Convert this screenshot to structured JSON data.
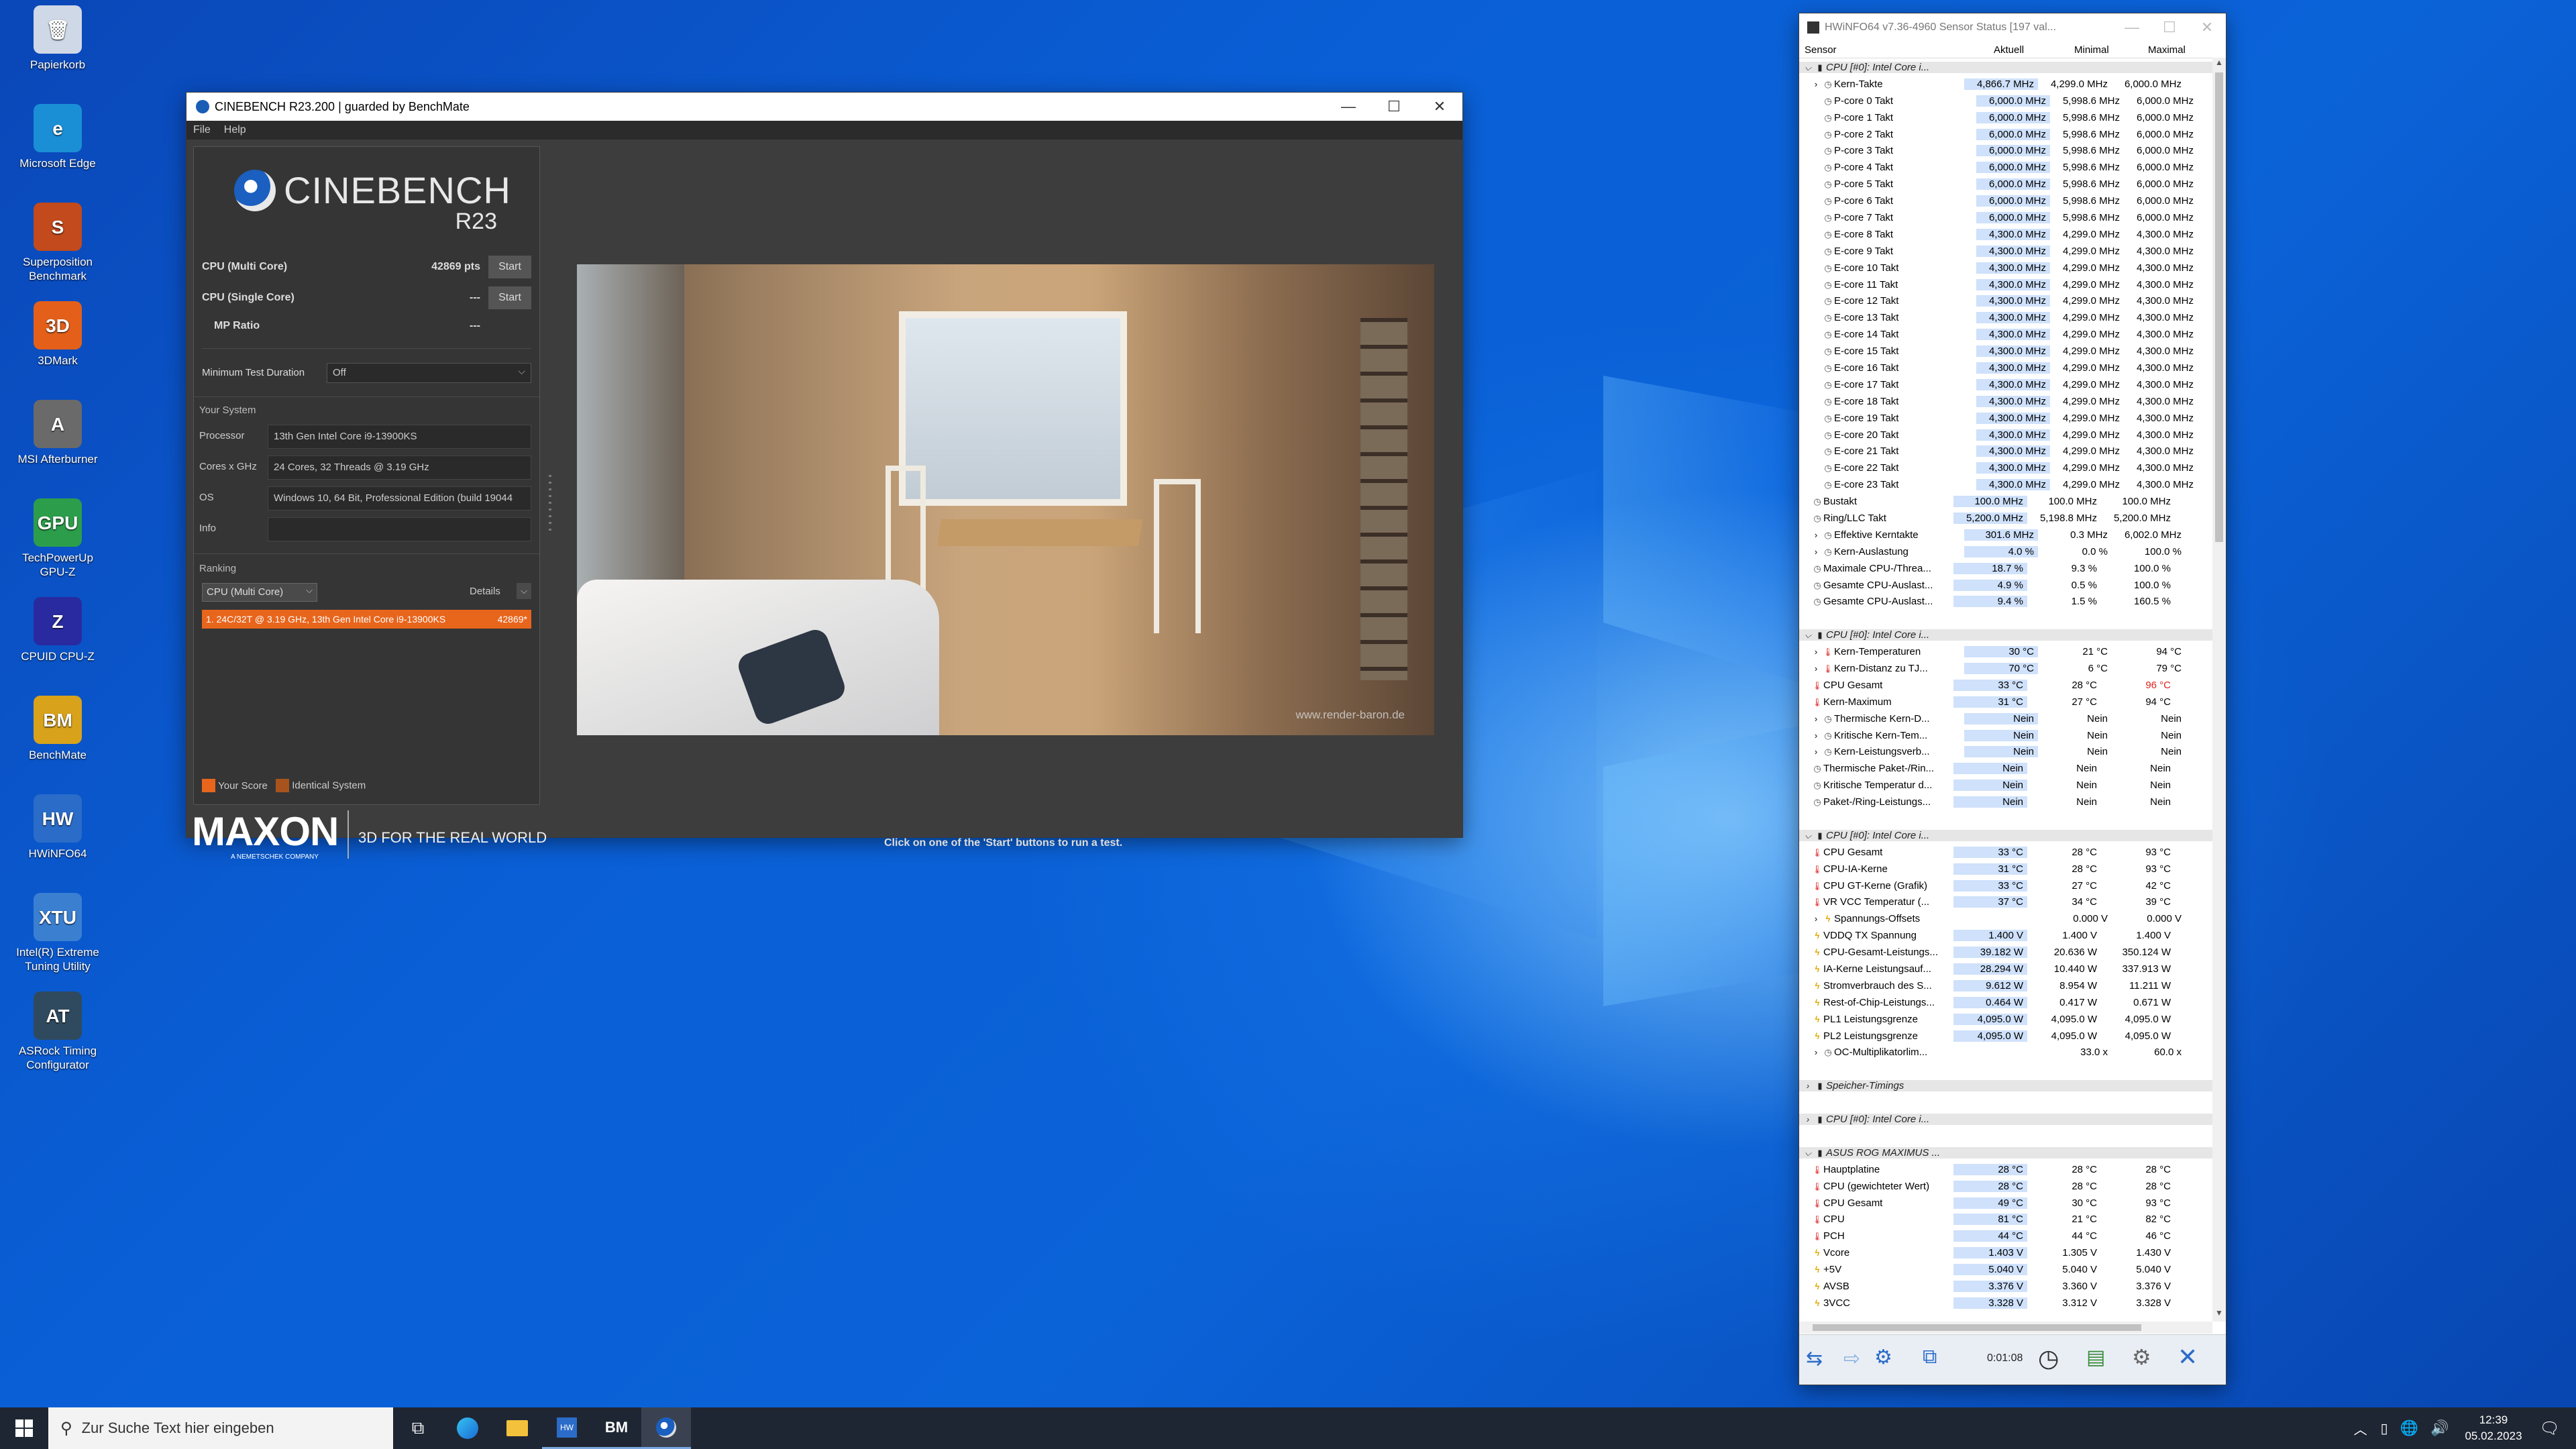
{
  "desktop": {
    "icons": [
      {
        "label": "Papierkorb",
        "glyph": "🗑",
        "color": "#cfd8e6"
      },
      {
        "label": "Microsoft Edge",
        "glyph": "e",
        "color": "#1a8fd6"
      },
      {
        "label": "Superposition Benchmark",
        "glyph": "S",
        "color": "#c24a1c"
      },
      {
        "label": "3DMark",
        "glyph": "3D",
        "color": "#e4601a"
      },
      {
        "label": "MSI Afterburner",
        "glyph": "A",
        "color": "#6a6a6a"
      },
      {
        "label": "TechPowerUp GPU-Z",
        "glyph": "GPU",
        "color": "#2c9e4b"
      },
      {
        "label": "CPUID CPU-Z",
        "glyph": "Z",
        "color": "#2a2aa0"
      },
      {
        "label": "BenchMate",
        "glyph": "BM",
        "color": "#d9a21b"
      },
      {
        "label": "HWiNFO64",
        "glyph": "HW",
        "color": "#2a6cc8"
      },
      {
        "label": "Intel(R) Extreme Tuning Utility",
        "glyph": "XTU",
        "color": "#3b7fd1"
      },
      {
        "label": "ASRock Timing Configurator",
        "glyph": "AT",
        "color": "#2f4a5e"
      }
    ]
  },
  "cinebench": {
    "title": "CINEBENCH R23.200 | guarded by BenchMate",
    "menu": [
      "File",
      "Help"
    ],
    "logo_text": "CINEBENCH",
    "logo_sub": "R23",
    "multi_label": "CPU (Multi Core)",
    "multi_score": "42869 pts",
    "single_label": "CPU (Single Core)",
    "single_score": "---",
    "mp_label": "MP Ratio",
    "mp_value": "---",
    "start": "Start",
    "min_duration_label": "Minimum Test Duration",
    "min_duration_value": "Off",
    "system_header": "Your System",
    "processor_label": "Processor",
    "processor_value": "13th Gen Intel Core i9-13900KS",
    "cores_label": "Cores x GHz",
    "cores_value": "24 Cores, 32 Threads @ 3.19 GHz",
    "os_label": "OS",
    "os_value": "Windows 10, 64 Bit, Professional Edition (build 19044",
    "info_label": "Info",
    "info_value": "",
    "ranking_header": "Ranking",
    "ranking_select": "CPU (Multi Core)",
    "details": "Details",
    "ranking_entry": "1. 24C/32T @ 3.19 GHz, 13th Gen Intel Core i9-13900KS",
    "ranking_score": "42869*",
    "legend_your": "Your Score",
    "legend_identical": "Identical System",
    "maxon": "MAXON",
    "maxon_sub": "A NEMETSCHEK COMPANY",
    "slogan": "3D FOR THE REAL WORLD",
    "hint": "Click on one of the 'Start' buttons to run a test.",
    "watermark": "www.render-baron.de"
  },
  "hwinfo": {
    "title": "HWiNFO64 v7.36-4960 Sensor Status [197 val...",
    "columns": [
      "Sensor",
      "Aktuell",
      "Minimal",
      "Maximal"
    ],
    "timer": "0:01:08",
    "rows": [
      {
        "t": "g",
        "n": "CPU [#0]: Intel Core i..."
      },
      {
        "t": "s",
        "i": 1,
        "n": "Kern-Takte",
        "a": "4,866.7 MHz",
        "mi": "4,299.0 MHz",
        "ma": "6,000.0 MHz",
        "ic": "c"
      },
      {
        "t": "s",
        "i": 2,
        "n": "P-core 0 Takt",
        "a": "6,000.0 MHz",
        "mi": "5,998.6 MHz",
        "ma": "6,000.0 MHz",
        "ic": "c"
      },
      {
        "t": "s",
        "i": 2,
        "n": "P-core 1 Takt",
        "a": "6,000.0 MHz",
        "mi": "5,998.6 MHz",
        "ma": "6,000.0 MHz",
        "ic": "c"
      },
      {
        "t": "s",
        "i": 2,
        "n": "P-core 2 Takt",
        "a": "6,000.0 MHz",
        "mi": "5,998.6 MHz",
        "ma": "6,000.0 MHz",
        "ic": "c"
      },
      {
        "t": "s",
        "i": 2,
        "n": "P-core 3 Takt",
        "a": "6,000.0 MHz",
        "mi": "5,998.6 MHz",
        "ma": "6,000.0 MHz",
        "ic": "c"
      },
      {
        "t": "s",
        "i": 2,
        "n": "P-core 4 Takt",
        "a": "6,000.0 MHz",
        "mi": "5,998.6 MHz",
        "ma": "6,000.0 MHz",
        "ic": "c"
      },
      {
        "t": "s",
        "i": 2,
        "n": "P-core 5 Takt",
        "a": "6,000.0 MHz",
        "mi": "5,998.6 MHz",
        "ma": "6,000.0 MHz",
        "ic": "c"
      },
      {
        "t": "s",
        "i": 2,
        "n": "P-core 6 Takt",
        "a": "6,000.0 MHz",
        "mi": "5,998.6 MHz",
        "ma": "6,000.0 MHz",
        "ic": "c"
      },
      {
        "t": "s",
        "i": 2,
        "n": "P-core 7 Takt",
        "a": "6,000.0 MHz",
        "mi": "5,998.6 MHz",
        "ma": "6,000.0 MHz",
        "ic": "c"
      },
      {
        "t": "s",
        "i": 2,
        "n": "E-core 8 Takt",
        "a": "4,300.0 MHz",
        "mi": "4,299.0 MHz",
        "ma": "4,300.0 MHz",
        "ic": "c"
      },
      {
        "t": "s",
        "i": 2,
        "n": "E-core 9 Takt",
        "a": "4,300.0 MHz",
        "mi": "4,299.0 MHz",
        "ma": "4,300.0 MHz",
        "ic": "c"
      },
      {
        "t": "s",
        "i": 2,
        "n": "E-core 10 Takt",
        "a": "4,300.0 MHz",
        "mi": "4,299.0 MHz",
        "ma": "4,300.0 MHz",
        "ic": "c"
      },
      {
        "t": "s",
        "i": 2,
        "n": "E-core 11 Takt",
        "a": "4,300.0 MHz",
        "mi": "4,299.0 MHz",
        "ma": "4,300.0 MHz",
        "ic": "c"
      },
      {
        "t": "s",
        "i": 2,
        "n": "E-core 12 Takt",
        "a": "4,300.0 MHz",
        "mi": "4,299.0 MHz",
        "ma": "4,300.0 MHz",
        "ic": "c"
      },
      {
        "t": "s",
        "i": 2,
        "n": "E-core 13 Takt",
        "a": "4,300.0 MHz",
        "mi": "4,299.0 MHz",
        "ma": "4,300.0 MHz",
        "ic": "c"
      },
      {
        "t": "s",
        "i": 2,
        "n": "E-core 14 Takt",
        "a": "4,300.0 MHz",
        "mi": "4,299.0 MHz",
        "ma": "4,300.0 MHz",
        "ic": "c"
      },
      {
        "t": "s",
        "i": 2,
        "n": "E-core 15 Takt",
        "a": "4,300.0 MHz",
        "mi": "4,299.0 MHz",
        "ma": "4,300.0 MHz",
        "ic": "c"
      },
      {
        "t": "s",
        "i": 2,
        "n": "E-core 16 Takt",
        "a": "4,300.0 MHz",
        "mi": "4,299.0 MHz",
        "ma": "4,300.0 MHz",
        "ic": "c"
      },
      {
        "t": "s",
        "i": 2,
        "n": "E-core 17 Takt",
        "a": "4,300.0 MHz",
        "mi": "4,299.0 MHz",
        "ma": "4,300.0 MHz",
        "ic": "c"
      },
      {
        "t": "s",
        "i": 2,
        "n": "E-core 18 Takt",
        "a": "4,300.0 MHz",
        "mi": "4,299.0 MHz",
        "ma": "4,300.0 MHz",
        "ic": "c"
      },
      {
        "t": "s",
        "i": 2,
        "n": "E-core 19 Takt",
        "a": "4,300.0 MHz",
        "mi": "4,299.0 MHz",
        "ma": "4,300.0 MHz",
        "ic": "c"
      },
      {
        "t": "s",
        "i": 2,
        "n": "E-core 20 Takt",
        "a": "4,300.0 MHz",
        "mi": "4,299.0 MHz",
        "ma": "4,300.0 MHz",
        "ic": "c"
      },
      {
        "t": "s",
        "i": 2,
        "n": "E-core 21 Takt",
        "a": "4,300.0 MHz",
        "mi": "4,299.0 MHz",
        "ma": "4,300.0 MHz",
        "ic": "c"
      },
      {
        "t": "s",
        "i": 2,
        "n": "E-core 22 Takt",
        "a": "4,300.0 MHz",
        "mi": "4,299.0 MHz",
        "ma": "4,300.0 MHz",
        "ic": "c"
      },
      {
        "t": "s",
        "i": 2,
        "n": "E-core 23 Takt",
        "a": "4,300.0 MHz",
        "mi": "4,299.0 MHz",
        "ma": "4,300.0 MHz",
        "ic": "c"
      },
      {
        "t": "s",
        "i": 0,
        "n": "Bustakt",
        "a": "100.0 MHz",
        "mi": "100.0 MHz",
        "ma": "100.0 MHz",
        "ic": "c"
      },
      {
        "t": "s",
        "i": 0,
        "n": "Ring/LLC Takt",
        "a": "5,200.0 MHz",
        "mi": "5,198.8 MHz",
        "ma": "5,200.0 MHz",
        "ic": "c"
      },
      {
        "t": "s",
        "i": 1,
        "n": "Effektive Kerntakte",
        "a": "301.6 MHz",
        "mi": "0.3 MHz",
        "ma": "6,002.0 MHz",
        "ic": "c"
      },
      {
        "t": "s",
        "i": 1,
        "n": "Kern-Auslastung",
        "a": "4.0 %",
        "mi": "0.0 %",
        "ma": "100.0 %",
        "ic": "c"
      },
      {
        "t": "s",
        "i": 0,
        "n": "Maximale CPU-/Threa...",
        "a": "18.7 %",
        "mi": "9.3 %",
        "ma": "100.0 %",
        "ic": "c"
      },
      {
        "t": "s",
        "i": 0,
        "n": "Gesamte CPU-Auslast...",
        "a": "4.9 %",
        "mi": "0.5 %",
        "ma": "100.0 %",
        "ic": "c"
      },
      {
        "t": "s",
        "i": 0,
        "n": "Gesamte CPU-Auslast...",
        "a": "9.4 %",
        "mi": "1.5 %",
        "ma": "160.5 %",
        "ic": "c"
      },
      {
        "t": "e"
      },
      {
        "t": "g",
        "n": "CPU [#0]: Intel Core i..."
      },
      {
        "t": "s",
        "i": 1,
        "n": "Kern-Temperaturen",
        "a": "30 °C",
        "mi": "21 °C",
        "ma": "94 °C",
        "ic": "t"
      },
      {
        "t": "s",
        "i": 1,
        "n": "Kern-Distanz zu TJ...",
        "a": "70 °C",
        "mi": "6 °C",
        "ma": "79 °C",
        "ic": "t"
      },
      {
        "t": "s",
        "i": 0,
        "n": "CPU Gesamt",
        "a": "33 °C",
        "mi": "28 °C",
        "ma": "96 °C",
        "ic": "t",
        "red": true
      },
      {
        "t": "s",
        "i": 0,
        "n": "Kern-Maximum",
        "a": "31 °C",
        "mi": "27 °C",
        "ma": "94 °C",
        "ic": "t"
      },
      {
        "t": "s",
        "i": 1,
        "n": "Thermische Kern-D...",
        "a": "Nein",
        "mi": "Nein",
        "ma": "Nein",
        "ic": "c"
      },
      {
        "t": "s",
        "i": 1,
        "n": "Kritische Kern-Tem...",
        "a": "Nein",
        "mi": "Nein",
        "ma": "Nein",
        "ic": "c"
      },
      {
        "t": "s",
        "i": 1,
        "n": "Kern-Leistungsverb...",
        "a": "Nein",
        "mi": "Nein",
        "ma": "Nein",
        "ic": "c"
      },
      {
        "t": "s",
        "i": 0,
        "n": "Thermische Paket-/Rin...",
        "a": "Nein",
        "mi": "Nein",
        "ma": "Nein",
        "ic": "c"
      },
      {
        "t": "s",
        "i": 0,
        "n": "Kritische Temperatur d...",
        "a": "Nein",
        "mi": "Nein",
        "ma": "Nein",
        "ic": "c"
      },
      {
        "t": "s",
        "i": 0,
        "n": "Paket-/Ring-Leistungs...",
        "a": "Nein",
        "mi": "Nein",
        "ma": "Nein",
        "ic": "c"
      },
      {
        "t": "e"
      },
      {
        "t": "g",
        "n": "CPU [#0]: Intel Core i..."
      },
      {
        "t": "s",
        "i": 0,
        "n": "CPU Gesamt",
        "a": "33 °C",
        "mi": "28 °C",
        "ma": "93 °C",
        "ic": "t"
      },
      {
        "t": "s",
        "i": 0,
        "n": "CPU-IA-Kerne",
        "a": "31 °C",
        "mi": "28 °C",
        "ma": "93 °C",
        "ic": "t"
      },
      {
        "t": "s",
        "i": 0,
        "n": "CPU GT-Kerne (Grafik)",
        "a": "33 °C",
        "mi": "27 °C",
        "ma": "42 °C",
        "ic": "t"
      },
      {
        "t": "s",
        "i": 0,
        "n": "VR VCC Temperatur (...",
        "a": "37 °C",
        "mi": "34 °C",
        "ma": "39 °C",
        "ic": "t"
      },
      {
        "t": "s",
        "i": 1,
        "n": "Spannungs-Offsets",
        "a": "",
        "mi": "0.000 V",
        "ma": "0.000 V",
        "ic": "v"
      },
      {
        "t": "s",
        "i": 0,
        "n": "VDDQ TX Spannung",
        "a": "1.400 V",
        "mi": "1.400 V",
        "ma": "1.400 V",
        "ic": "v"
      },
      {
        "t": "s",
        "i": 0,
        "n": "CPU-Gesamt-Leistungs...",
        "a": "39.182 W",
        "mi": "20.636 W",
        "ma": "350.124 W",
        "ic": "v"
      },
      {
        "t": "s",
        "i": 0,
        "n": "IA-Kerne Leistungsauf...",
        "a": "28.294 W",
        "mi": "10.440 W",
        "ma": "337.913 W",
        "ic": "v"
      },
      {
        "t": "s",
        "i": 0,
        "n": "Stromverbrauch des S...",
        "a": "9.612 W",
        "mi": "8.954 W",
        "ma": "11.211 W",
        "ic": "v"
      },
      {
        "t": "s",
        "i": 0,
        "n": "Rest-of-Chip-Leistungs...",
        "a": "0.464 W",
        "mi": "0.417 W",
        "ma": "0.671 W",
        "ic": "v"
      },
      {
        "t": "s",
        "i": 0,
        "n": "PL1 Leistungsgrenze",
        "a": "4,095.0 W",
        "mi": "4,095.0 W",
        "ma": "4,095.0 W",
        "ic": "v"
      },
      {
        "t": "s",
        "i": 0,
        "n": "PL2 Leistungsgrenze",
        "a": "4,095.0 W",
        "mi": "4,095.0 W",
        "ma": "4,095.0 W",
        "ic": "v"
      },
      {
        "t": "s",
        "i": 1,
        "n": "OC-Multiplikatorlim...",
        "a": "",
        "mi": "33.0 x",
        "ma": "60.0 x",
        "ic": "c"
      },
      {
        "t": "e"
      },
      {
        "t": "gc",
        "n": "Speicher-Timings"
      },
      {
        "t": "e"
      },
      {
        "t": "gc",
        "n": "CPU [#0]: Intel Core i..."
      },
      {
        "t": "e"
      },
      {
        "t": "g",
        "n": "ASUS ROG MAXIMUS ..."
      },
      {
        "t": "s",
        "i": 0,
        "n": "Hauptplatine",
        "a": "28 °C",
        "mi": "28 °C",
        "ma": "28 °C",
        "ic": "t"
      },
      {
        "t": "s",
        "i": 0,
        "n": "CPU (gewichteter Wert)",
        "a": "28 °C",
        "mi": "28 °C",
        "ma": "28 °C",
        "ic": "t"
      },
      {
        "t": "s",
        "i": 0,
        "n": "CPU Gesamt",
        "a": "49 °C",
        "mi": "30 °C",
        "ma": "93 °C",
        "ic": "t"
      },
      {
        "t": "s",
        "i": 0,
        "n": "CPU",
        "a": "81 °C",
        "mi": "21 °C",
        "ma": "82 °C",
        "ic": "t"
      },
      {
        "t": "s",
        "i": 0,
        "n": "PCH",
        "a": "44 °C",
        "mi": "44 °C",
        "ma": "46 °C",
        "ic": "t"
      },
      {
        "t": "s",
        "i": 0,
        "n": "Vcore",
        "a": "1.403 V",
        "mi": "1.305 V",
        "ma": "1.430 V",
        "ic": "v"
      },
      {
        "t": "s",
        "i": 0,
        "n": "+5V",
        "a": "5.040 V",
        "mi": "5.040 V",
        "ma": "5.040 V",
        "ic": "v"
      },
      {
        "t": "s",
        "i": 0,
        "n": "AVSB",
        "a": "3.376 V",
        "mi": "3.360 V",
        "ma": "3.376 V",
        "ic": "v"
      },
      {
        "t": "s",
        "i": 0,
        "n": "3VCC",
        "a": "3.328 V",
        "mi": "3.312 V",
        "ma": "3.328 V",
        "ic": "v"
      }
    ]
  },
  "taskbar": {
    "search_placeholder": "Zur Suche Text hier eingeben",
    "time": "12:39",
    "date": "05.02.2023"
  },
  "colors": {
    "accent": "#e8651c",
    "hw_current": "#cfe1fb",
    "taskbar": "#1f2633"
  }
}
